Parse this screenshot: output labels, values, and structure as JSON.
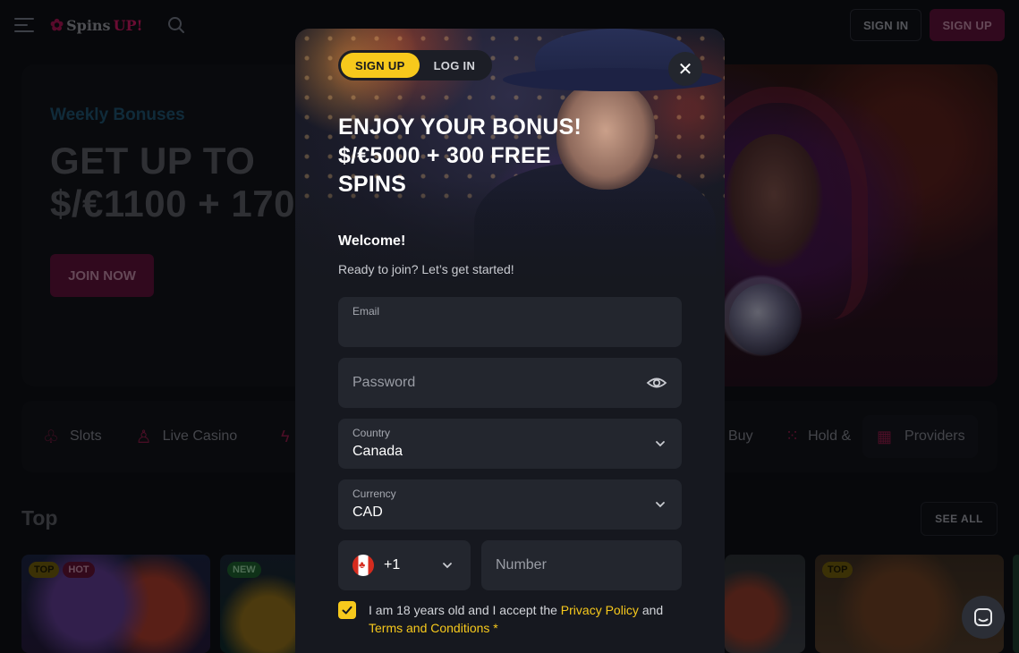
{
  "header": {
    "logo_text": "Spins",
    "logo_text_accent": "UP!",
    "signin_label": "SIGN IN",
    "signup_label": "SIGN UP"
  },
  "hero": {
    "subtitle": "Weekly Bonuses",
    "title_line1": "GET UP TO",
    "title_line2": "$/€1100 + 170",
    "button_label": "JOIN NOW"
  },
  "categories": {
    "slots": "Slots",
    "live_casino": "Live Casino",
    "bonus_buy": "Buy",
    "hold": "Hold &",
    "providers": "Providers"
  },
  "top_section": {
    "title": "Top",
    "see_all_label": "SEE ALL",
    "badges": {
      "top": "TOP",
      "hot": "HOT",
      "new": "NEW"
    }
  },
  "modal": {
    "tabs": {
      "signup": "SIGN UP",
      "login": "LOG IN"
    },
    "bonus_title": "ENJOY YOUR BONUS! $/€5000 + 300 FREE SPINS",
    "welcome": "Welcome!",
    "welcome_sub": "Ready to join? Let’s get started!",
    "fields": {
      "email_label": "Email",
      "email_value": "",
      "password_placeholder": "Password",
      "country_label": "Country",
      "country_value": "Canada",
      "currency_label": "Currency",
      "currency_value": "CAD",
      "phone_code": "+1",
      "phone_placeholder": "Number"
    },
    "consent": {
      "text_before": "I am 18 years old and I accept the ",
      "privacy_link": "Privacy Policy",
      "text_and": " and ",
      "terms_link": "Terms and Conditions",
      "required_mark": "*",
      "checked": true
    }
  },
  "colors": {
    "accent_yellow": "#f7c91c",
    "brand_magenta": "#5a1237",
    "background": "#0d0f14",
    "field_bg": "#23262e"
  },
  "icons": {
    "menu": "hamburger-icon",
    "search": "search-icon",
    "close": "close-icon",
    "password_toggle": "eye-icon",
    "dropdown": "chevron-down-icon",
    "flag": "canada-flag-icon",
    "chat": "chat-icon",
    "checkbox": "check-icon"
  }
}
